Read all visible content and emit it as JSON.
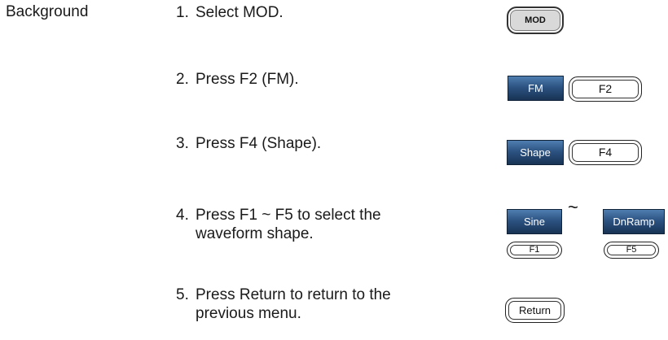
{
  "section_label": "Background",
  "steps": [
    {
      "num": "1.",
      "line1": "Select MOD.",
      "line2": ""
    },
    {
      "num": "2.",
      "line1": "Press F2 (FM).",
      "line2": ""
    },
    {
      "num": "3.",
      "line1": "Press F4 (Shape).",
      "line2": ""
    },
    {
      "num": "4.",
      "line1": "Press F1 ~ F5 to select the",
      "line2": "waveform shape."
    },
    {
      "num": "5.",
      "line1": "Press Return to return to the",
      "line2": "previous menu."
    }
  ],
  "buttons": {
    "mod": "MOD",
    "fm": "FM",
    "f2": "F2",
    "shape": "Shape",
    "f4": "F4",
    "sine": "Sine",
    "tilde": "~",
    "dnramp": "DnRamp",
    "f1": "F1",
    "f5": "F5",
    "return": "Return"
  }
}
